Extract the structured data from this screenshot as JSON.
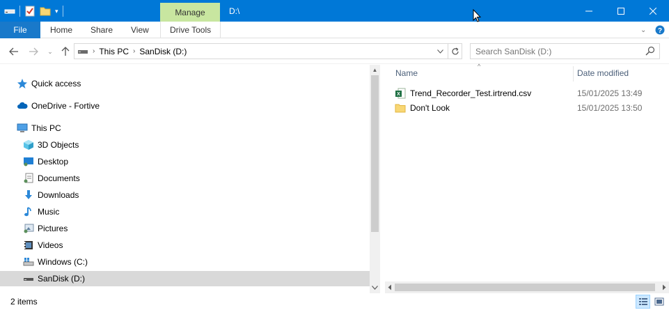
{
  "window": {
    "title": "D:\\",
    "manage_tab": "Manage",
    "minimize": "—",
    "maximize": "☐",
    "close": "✕"
  },
  "ribbon": {
    "file": "File",
    "tabs": [
      "Home",
      "Share",
      "View"
    ],
    "drive_tools": "Drive Tools"
  },
  "address": {
    "crumbs": [
      "This PC",
      "SanDisk (D:)"
    ],
    "search_placeholder": "Search SanDisk (D:)"
  },
  "nav": {
    "items": [
      {
        "label": "Quick access",
        "icon": "star-icon"
      },
      {
        "label": "OneDrive - Fortive",
        "icon": "cloud-icon"
      },
      {
        "label": "This PC",
        "icon": "computer-icon"
      },
      {
        "label": "3D Objects",
        "icon": "cube-icon"
      },
      {
        "label": "Desktop",
        "icon": "desktop-icon"
      },
      {
        "label": "Documents",
        "icon": "documents-icon"
      },
      {
        "label": "Downloads",
        "icon": "download-icon"
      },
      {
        "label": "Music",
        "icon": "music-icon"
      },
      {
        "label": "Pictures",
        "icon": "pictures-icon"
      },
      {
        "label": "Videos",
        "icon": "videos-icon"
      },
      {
        "label": "Windows (C:)",
        "icon": "drive-c-icon"
      },
      {
        "label": "SanDisk (D:)",
        "icon": "usb-drive-icon"
      }
    ]
  },
  "columns": {
    "name": "Name",
    "date_modified": "Date modified"
  },
  "files": [
    {
      "name": "Trend_Recorder_Test.irtrend.csv",
      "date": "15/01/2025 13:49",
      "icon": "excel-csv-icon"
    },
    {
      "name": "Don't Look",
      "date": "15/01/2025 13:50",
      "icon": "folder-icon"
    }
  ],
  "status": {
    "count": "2 items"
  },
  "colors": {
    "titlebar": "#0078d7",
    "file_tab": "#1979ca",
    "manage_tab": "#c8e6a0",
    "selection": "#d9d9d9"
  }
}
